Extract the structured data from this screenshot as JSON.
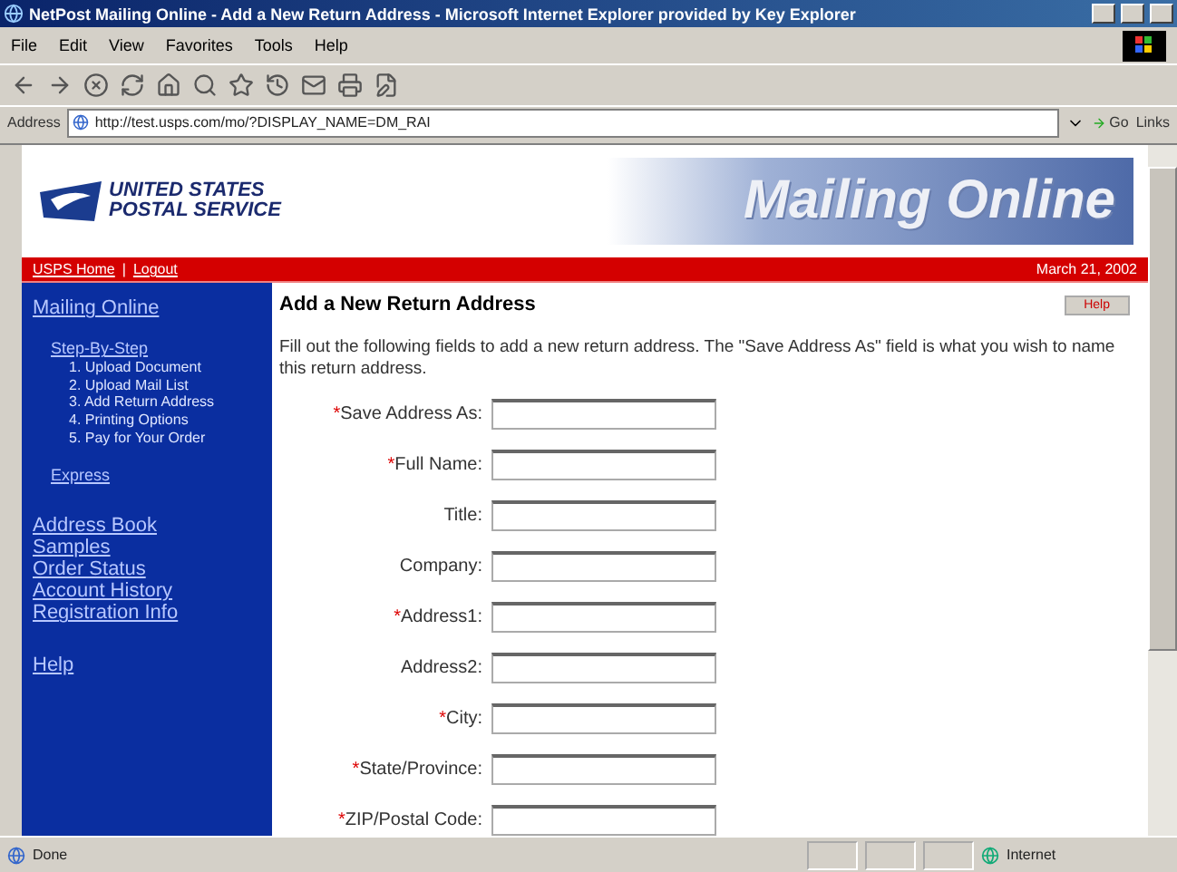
{
  "window": {
    "title": "NetPost Mailing Online - Add a New Return Address - Microsoft Internet Explorer provided by Key Explorer"
  },
  "menu": [
    "File",
    "Edit",
    "View",
    "Favorites",
    "Tools",
    "Help"
  ],
  "address_bar": {
    "label": "Address",
    "url": "http://test.usps.com/mo/?DISPLAY_NAME=DM_RAI",
    "go": "Go",
    "links": "Links"
  },
  "header": {
    "logo_line_1": "UNITED STATES",
    "logo_line_2": "POSTAL SERVICE",
    "banner": "Mailing Online"
  },
  "top_bar": {
    "links": [
      "USPS Home",
      "Logout"
    ],
    "separator": "|",
    "date": "March 21, 2002"
  },
  "sidebar": {
    "title": "Mailing Online",
    "step_heading": "Step-By-Step",
    "steps": [
      "1. Upload Document",
      "2. Upload Mail List",
      "3. Add Return Address",
      "4. Printing Options",
      "5. Pay for Your Order"
    ],
    "express": "Express",
    "links": [
      "Address Book",
      "Samples",
      "Order Status",
      "Account History",
      "Registration Info"
    ],
    "help": "Help"
  },
  "main": {
    "heading": "Add a New Return Address",
    "help_button": "Help",
    "intro": "Fill out the following fields to add a new return address. The \"Save Address As\" field is what you wish to name this return address.",
    "fields": [
      {
        "mark": "*",
        "label": "Save Address As:"
      },
      {
        "mark": "*",
        "label": "Full Name:"
      },
      {
        "label": "Title:"
      },
      {
        "label": "Company:"
      },
      {
        "mark": "*",
        "label": "Address1:"
      },
      {
        "label": "Address2:"
      },
      {
        "mark": "*",
        "label": "City:"
      },
      {
        "mark": "*",
        "label": "State/Province:"
      },
      {
        "mark": "*",
        "label": "ZIP/Postal Code:"
      }
    ]
  },
  "status_bar": {
    "text": "Done",
    "zone": "Internet"
  }
}
